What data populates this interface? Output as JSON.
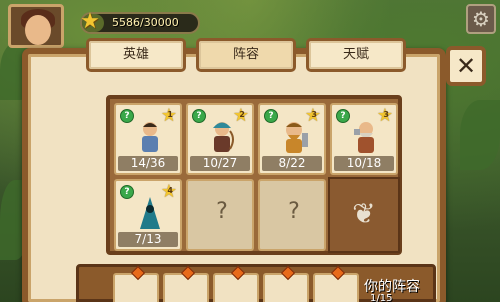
{
  "hud": {
    "xp_text": "5586/30000",
    "xp_fraction": 0.19,
    "settings_icon": "gear-icon"
  },
  "tabs": [
    {
      "label": "英雄",
      "active": false
    },
    {
      "label": "阵容",
      "active": true
    },
    {
      "label": "天赋",
      "active": false
    }
  ],
  "close_label": "✕",
  "heroes": [
    {
      "count": "14/36",
      "stars": "1",
      "color": "#5b7fb0"
    },
    {
      "count": "10/27",
      "stars": "2",
      "color": "#2f8a9a"
    },
    {
      "count": "8/22",
      "stars": "3",
      "color": "#c8862a"
    },
    {
      "count": "10/18",
      "stars": "3",
      "color": "#a0522d"
    },
    {
      "count": "7/13",
      "stars": "4",
      "color": "#1f7a8a"
    }
  ],
  "empty_slots": [
    "?",
    "?"
  ],
  "lineup": {
    "label": "你的阵容",
    "sub": "1/15"
  }
}
